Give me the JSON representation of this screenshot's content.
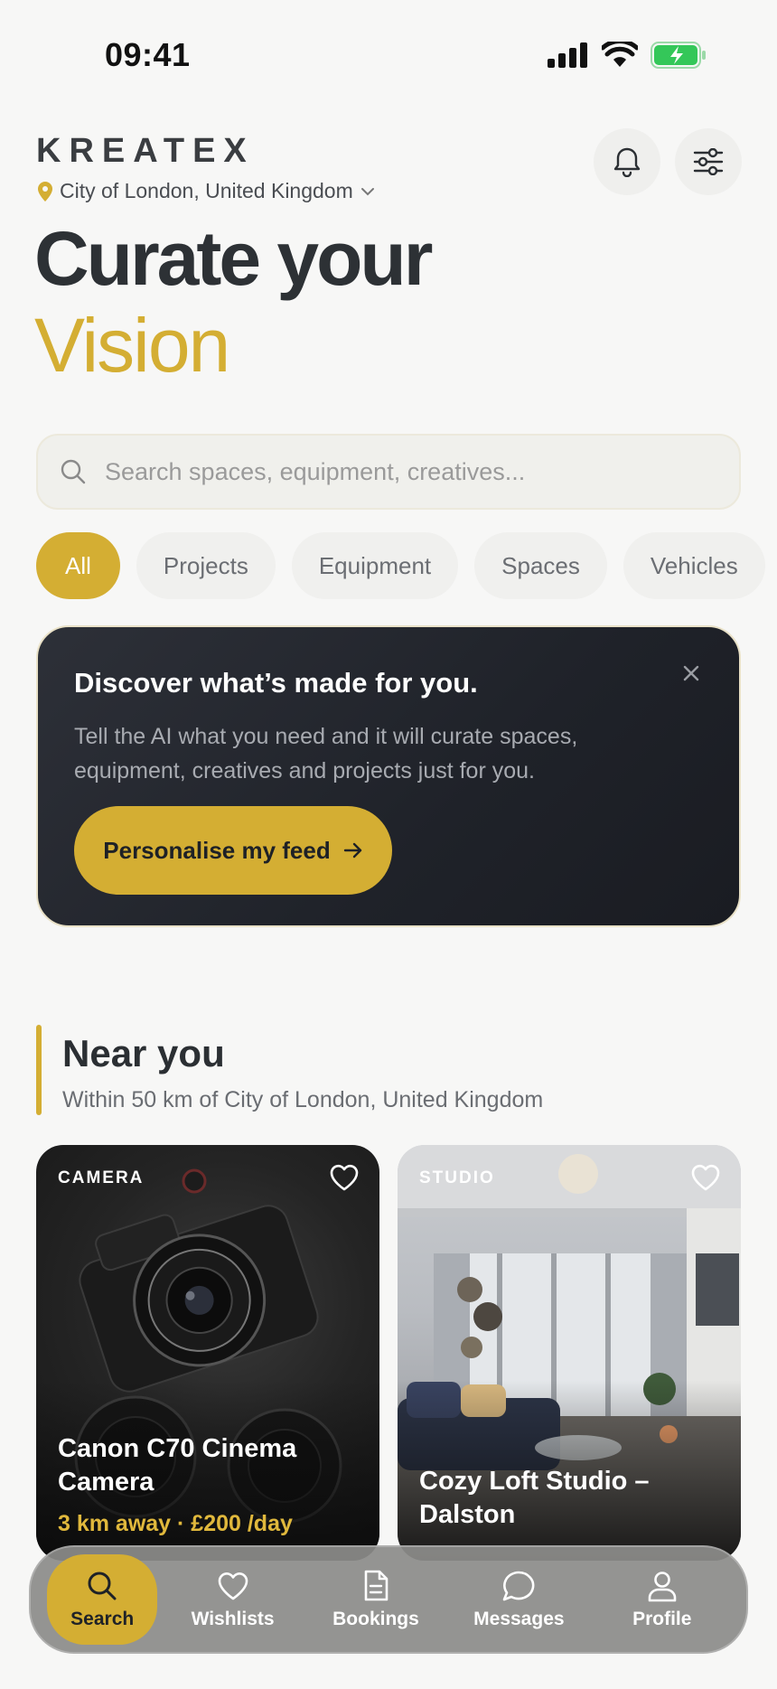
{
  "status": {
    "time": "09:41"
  },
  "header": {
    "brand": "KREATEX",
    "location": "City of London, United Kingdom"
  },
  "hero": {
    "line1": "Curate your",
    "line2": "Vision"
  },
  "search": {
    "placeholder": "Search spaces, equipment, creatives..."
  },
  "chips": [
    "All",
    "Projects",
    "Equipment",
    "Spaces",
    "Vehicles"
  ],
  "promo": {
    "title": "Discover what’s made for you.",
    "description": "Tell the AI what you need and it will curate spaces, equipment, creatives and projects just for you.",
    "button": "Personalise my feed"
  },
  "near": {
    "title": "Near you",
    "subtitle": "Within 50 km of City of London, United Kingdom",
    "cards": [
      {
        "tag": "CAMERA",
        "title": "Canon C70 Cinema Camera",
        "meta": "3 km away · £200 /day"
      },
      {
        "tag": "STUDIO",
        "title": "Cozy Loft Studio – Dalston",
        "meta": ""
      }
    ]
  },
  "tabbar": {
    "items": [
      {
        "label": "Search",
        "icon": "search-icon"
      },
      {
        "label": "Wishlists",
        "icon": "heart-icon"
      },
      {
        "label": "Bookings",
        "icon": "document-icon"
      },
      {
        "label": "Messages",
        "icon": "chat-bubble-icon"
      },
      {
        "label": "Profile",
        "icon": "person-icon"
      }
    ]
  },
  "colors": {
    "accent": "#d4ae33",
    "dark_card": "#1f2229",
    "background": "#f7f7f6",
    "battery": "#34c759"
  }
}
